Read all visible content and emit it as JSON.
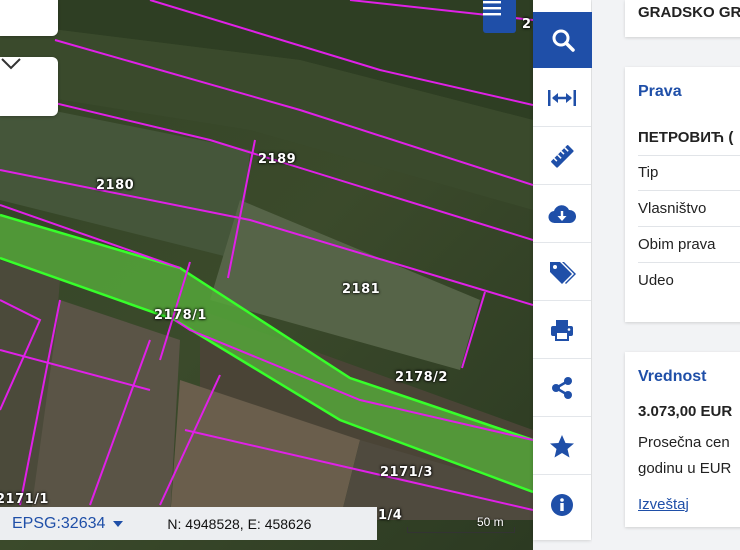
{
  "map": {
    "parcels": [
      "2189",
      "2180",
      "2181",
      "2178/1",
      "2178/2",
      "2171/3",
      "2171/1",
      "1/4",
      "2"
    ],
    "menu_icon": "hamburger-menu-icon",
    "dropdown_icon": "chevron-down-icon"
  },
  "status_bar": {
    "epsg": "EPSG:32634",
    "coords": "N: 4948528, E: 458626"
  },
  "scale": {
    "label": "50 m"
  },
  "toolbar": {
    "tools": [
      {
        "name": "search-icon"
      },
      {
        "name": "measure-distance-icon"
      },
      {
        "name": "ruler-icon"
      },
      {
        "name": "cloud-download-icon"
      },
      {
        "name": "tags-icon"
      },
      {
        "name": "print-icon"
      },
      {
        "name": "share-icon"
      },
      {
        "name": "star-icon"
      },
      {
        "name": "info-icon"
      }
    ],
    "accent": "#1f4fa8"
  },
  "panel": {
    "top_card_text": "GRADSKO GR",
    "prava": {
      "title": "Prava",
      "owner": "ПЕТРОВИЋ (",
      "rows": [
        "Tip",
        "Vlasništvo",
        "Obim prava",
        "Udeo"
      ]
    },
    "vrednost": {
      "title": "Vrednost",
      "amount": "3.073,00 EUR",
      "desc_line1": "Prosečna cen",
      "desc_line2": "godinu u EUR",
      "link": "Izveštaj"
    }
  }
}
